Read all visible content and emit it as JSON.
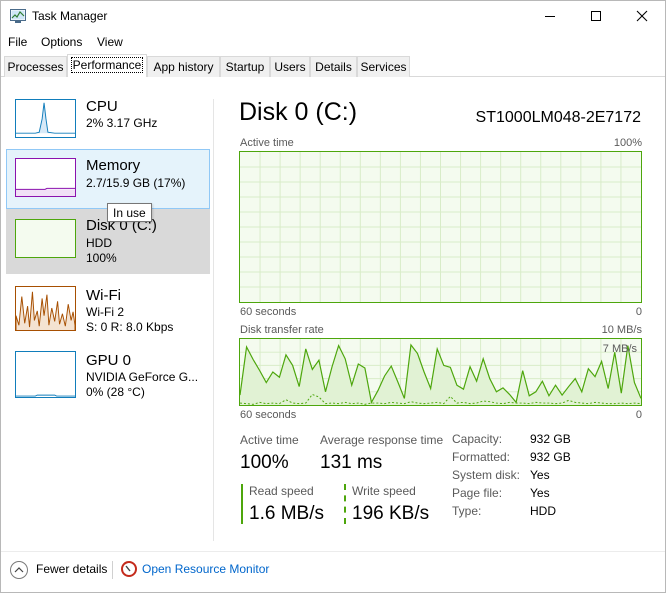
{
  "window": {
    "title": "Task Manager"
  },
  "menu": {
    "file": "File",
    "options": "Options",
    "view": "View"
  },
  "tabs": [
    "Processes",
    "Performance",
    "App history",
    "Startup",
    "Users",
    "Details",
    "Services"
  ],
  "active_tab": "Performance",
  "resources": [
    {
      "name": "CPU",
      "line1": "2%  3.17 GHz",
      "line2": ""
    },
    {
      "name": "Memory",
      "line1": "2.7/15.9 GB (17%)",
      "line2": ""
    },
    {
      "name": "Disk 0 (C:)",
      "line1": "HDD",
      "line2": "100%"
    },
    {
      "name": "Wi-Fi",
      "line1": "Wi-Fi 2",
      "line2": "S: 0  R: 8.0 Kbps"
    },
    {
      "name": "GPU 0",
      "line1": "NVIDIA GeForce G...",
      "line2": "0%  (28 °C)"
    }
  ],
  "tooltip": "In use",
  "disk": {
    "title": "Disk 0 (C:)",
    "model": "ST1000LM048-2E7172",
    "active_time_graph": {
      "label": "Active time",
      "max_label": "100%",
      "xlabel": "60 seconds",
      "min_label": "0"
    },
    "transfer_graph": {
      "label": "Disk transfer rate",
      "max_label": "10 MB/s",
      "mid_label": "7 MB/s",
      "xlabel": "60 seconds",
      "min_label": "0"
    },
    "stats": {
      "active_time_label": "Active time",
      "active_time": "100%",
      "response_label": "Average response time",
      "response": "131 ms",
      "read_label": "Read speed",
      "read": "1.6 MB/s",
      "write_label": "Write speed",
      "write": "196 KB/s"
    },
    "properties": [
      {
        "label": "Capacity:",
        "value": "932 GB"
      },
      {
        "label": "Formatted:",
        "value": "932 GB"
      },
      {
        "label": "System disk:",
        "value": "Yes"
      },
      {
        "label": "Page file:",
        "value": "Yes"
      },
      {
        "label": "Type:",
        "value": "HDD"
      }
    ]
  },
  "transfer_series": [
    1.5,
    8.8,
    6.9,
    5.2,
    3.4,
    5.0,
    4.2,
    7.6,
    6.0,
    2.8,
    8.5,
    5.4,
    6.8,
    2.0,
    5.8,
    9.0,
    7.0,
    3.0,
    6.2,
    5.6,
    0.4,
    2.2,
    4.4,
    5.9,
    3.5,
    1.0,
    9.1,
    7.8,
    5.0,
    2.5,
    8.5,
    6.0,
    5.7,
    3.0,
    2.4,
    5.8,
    3.6,
    7.0,
    4.0,
    2.0,
    2.6,
    1.6,
    0.4,
    5.2,
    1.4,
    2.0,
    3.6,
    1.4,
    3.0,
    1.5,
    2.8,
    4.0,
    2.0,
    5.5,
    4.3,
    6.6,
    2.5,
    8.0,
    1.8,
    9.0,
    3.4,
    1.0
  ],
  "write_series": [
    0.3,
    0.2,
    0.1,
    0.4,
    0.2,
    0.3,
    0.2,
    0.8,
    0.3,
    0.2,
    0.3,
    1.6,
    1.2,
    0.2,
    0.3,
    0.2,
    0.4,
    0.2,
    0.3,
    0.1,
    0.3,
    0.3,
    0.2,
    0.4,
    0.3,
    0.2,
    0.5,
    0.3,
    0.2,
    0.3,
    0.4,
    0.2,
    1.3,
    0.3,
    0.4,
    0.2,
    0.3,
    0.6,
    0.5,
    0.3,
    0.2,
    0.4,
    0.3,
    0.3,
    0.2,
    0.4,
    0.3,
    0.3,
    0.2,
    0.3,
    0.7,
    0.4,
    0.3,
    0.2,
    0.4,
    0.3,
    0.2,
    0.2,
    0.3,
    0.2,
    0.3,
    0.2
  ],
  "bottom": {
    "fewer": "Fewer details",
    "monitor": "Open Resource Monitor"
  },
  "colors": {
    "disk": "#4da60c",
    "cpu": "#117dbb",
    "memory": "#8b12ae",
    "wifi": "#a74f01",
    "gpu": "#117dbb",
    "link": "#0066cc"
  }
}
